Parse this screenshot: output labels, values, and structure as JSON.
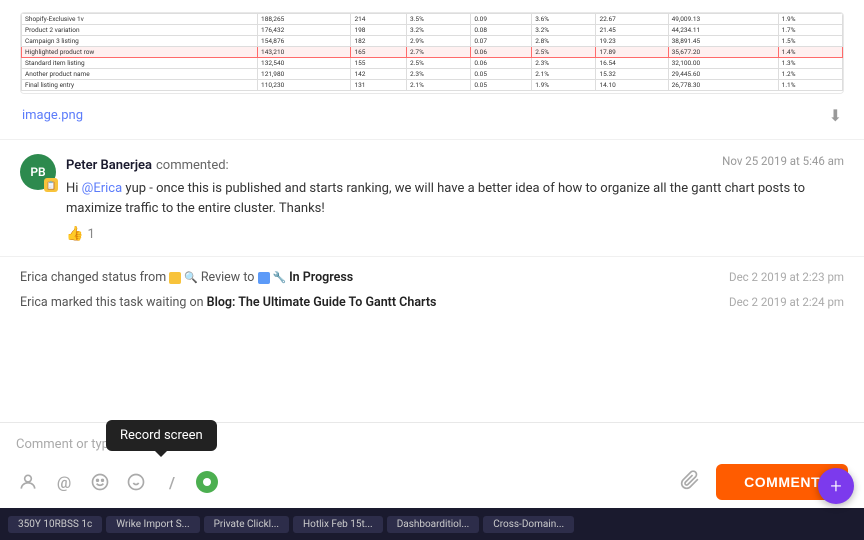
{
  "image": {
    "name": "image.png",
    "download_label": "⬇"
  },
  "comment": {
    "avatar_initials": "PB",
    "avatar_badge": "📋",
    "author": "Peter Banerjea",
    "action": "commented:",
    "timestamp": "Nov 25 2019 at 5:46 am",
    "mention": "@Erica",
    "text_before_mention": "Hi ",
    "text_after_mention": " yup - once this is published and starts ranking, we will have a better idea of how to organize all the gantt chart posts to maximize traffic to the entire cluster. Thanks!",
    "like_count": "1"
  },
  "activity": [
    {
      "text": "Erica changed status from",
      "from_label": "Review",
      "to_word": "to",
      "to_label": "In Progress",
      "timestamp": "Dec 2 2019 at 2:23 pm"
    },
    {
      "text": "Erica marked this task waiting on",
      "link": "Blog: The Ultimate Guide To Gantt Charts",
      "timestamp": "Dec 2 2019 at 2:24 pm"
    }
  ],
  "input": {
    "placeholder": "Comment or type '/' for commands",
    "record_tooltip": "Record screen",
    "comment_button": "COMMENT"
  },
  "toolbar_icons": {
    "person_icon": "👤",
    "at_icon": "@",
    "emoji_happy": "😊",
    "emoji_face": "🙂",
    "slash_icon": "/",
    "attach_icon": "📎"
  },
  "taskbar": {
    "items": [
      "350Y 10RBSS 1c",
      "Wrike Import S...",
      "Private Clickl...",
      "Hotlix Feb 15t...",
      "Dashboarditiol...",
      "Cross-Domain..."
    ]
  },
  "fab": {
    "icon": "+"
  }
}
